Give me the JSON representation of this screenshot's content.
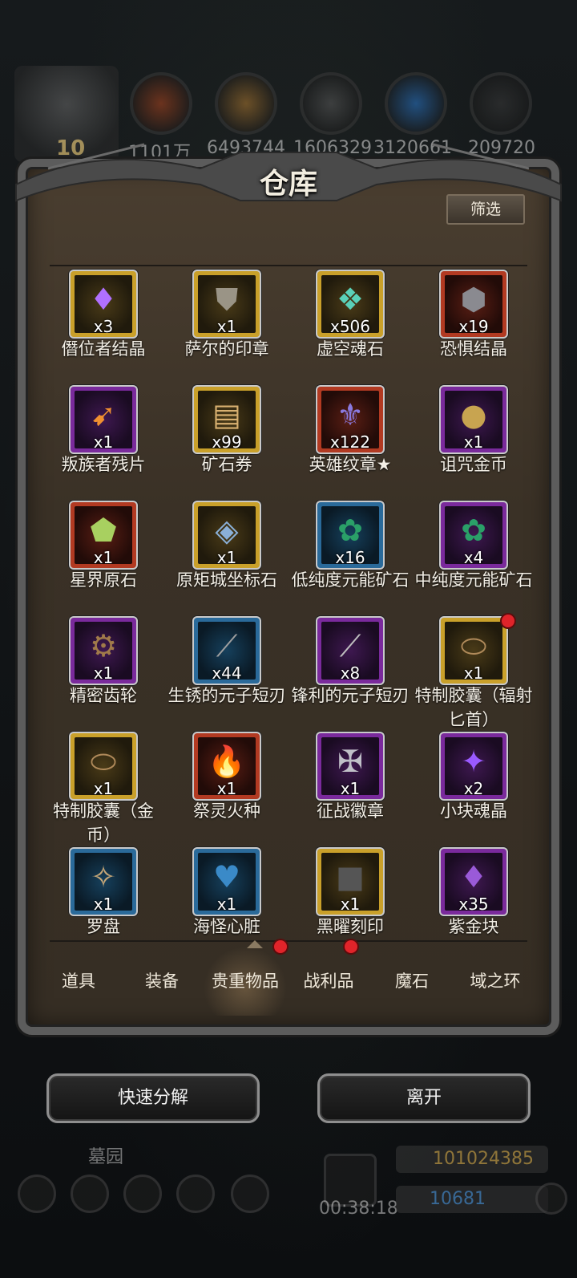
{
  "topbar": {
    "level": "10",
    "resources": [
      {
        "value": "1101万",
        "icon": "wood-log-icon",
        "color": "#b0461e"
      },
      {
        "value": "6493744",
        "icon": "planks-icon",
        "color": "#b07a30"
      },
      {
        "value": "1606329",
        "icon": "iron-ingot-icon",
        "color": "#5a5a5a"
      },
      {
        "value": "3120661",
        "icon": "crystal-icon",
        "color": "#2a7ad0"
      },
      {
        "value": "209720",
        "icon": "black-ingot-icon",
        "color": "#3a3a3a"
      }
    ]
  },
  "panel": {
    "title": "仓库",
    "filter_label": "筛选"
  },
  "items": [
    {
      "name": "僭位者结晶",
      "count": "x3",
      "rarity": "gold",
      "icon": "purple-crystal-icon",
      "glyph": "♦",
      "glyph_color": "#b070ff"
    },
    {
      "name": "萨尔的印章",
      "count": "x1",
      "rarity": "gold",
      "icon": "shield-emblem-icon",
      "glyph": "⛊",
      "glyph_color": "#9a9486"
    },
    {
      "name": "虚空魂石",
      "count": "x506",
      "rarity": "gold",
      "icon": "void-soulstone-icon",
      "glyph": "❖",
      "glyph_color": "#5ad0b8"
    },
    {
      "name": "恐惧结晶",
      "count": "x19",
      "rarity": "red",
      "icon": "fear-crystal-icon",
      "glyph": "⬢",
      "glyph_color": "#8a8a90"
    },
    {
      "name": "叛族者残片",
      "count": "x1",
      "rarity": "purple",
      "icon": "fragment-icon",
      "glyph": "➹",
      "glyph_color": "#f09030"
    },
    {
      "name": "矿石券",
      "count": "x99",
      "rarity": "gold",
      "icon": "scroll-icon",
      "glyph": "▤",
      "glyph_color": "#d8b070"
    },
    {
      "name": "英雄纹章★",
      "count": "x122",
      "rarity": "red",
      "icon": "hero-crest-icon",
      "glyph": "⚜",
      "glyph_color": "#8a7ae0"
    },
    {
      "name": "诅咒金币",
      "count": "x1",
      "rarity": "purple",
      "icon": "cursed-coin-icon",
      "glyph": "●",
      "glyph_color": "#c8a450"
    },
    {
      "name": "星界原石",
      "count": "x1",
      "rarity": "red",
      "icon": "astral-stone-icon",
      "glyph": "⬟",
      "glyph_color": "#a8d060"
    },
    {
      "name": "原矩城坐标石",
      "count": "x1",
      "rarity": "gold",
      "icon": "coordinate-cube-icon",
      "glyph": "◈",
      "glyph_color": "#8ab0d8"
    },
    {
      "name": "低纯度元能矿石",
      "count": "x16",
      "rarity": "blue",
      "icon": "ore-cluster-icon",
      "glyph": "✿",
      "glyph_color": "#2aa068"
    },
    {
      "name": "中纯度元能矿石",
      "count": "x4",
      "rarity": "purple",
      "icon": "ore-cluster-icon",
      "glyph": "✿",
      "glyph_color": "#2aa068"
    },
    {
      "name": "精密齿轮",
      "count": "x1",
      "rarity": "purple",
      "icon": "gear-icon",
      "glyph": "⚙",
      "glyph_color": "#a07a4a"
    },
    {
      "name": "生锈的元子短刃",
      "count": "x44",
      "rarity": "blue",
      "icon": "blade-icon",
      "glyph": "⟋",
      "glyph_color": "#a0a0a0"
    },
    {
      "name": "锋利的元子短刃",
      "count": "x8",
      "rarity": "purple",
      "icon": "blade-icon",
      "glyph": "⟋",
      "glyph_color": "#c0c0c0"
    },
    {
      "name": "特制胶囊（辐射匕首）",
      "count": "x1",
      "rarity": "gold",
      "icon": "capsule-icon",
      "glyph": "⬭",
      "glyph_color": "#b08a5a"
    },
    {
      "name": "特制胶囊（金币）",
      "count": "x1",
      "rarity": "gold",
      "icon": "capsule-icon",
      "glyph": "⬭",
      "glyph_color": "#b08a5a"
    },
    {
      "name": "祭灵火种",
      "count": "x1",
      "rarity": "red",
      "icon": "flame-icon",
      "glyph": "🔥",
      "glyph_color": "#ff9a30"
    },
    {
      "name": "征战徽章",
      "count": "x1",
      "rarity": "purple",
      "icon": "war-badge-icon",
      "glyph": "✠",
      "glyph_color": "#c0c0c8"
    },
    {
      "name": "小块魂晶",
      "count": "x2",
      "rarity": "purple",
      "icon": "soul-crystal-icon",
      "glyph": "✦",
      "glyph_color": "#9a5aff"
    },
    {
      "name": "罗盘",
      "count": "x1",
      "rarity": "blue",
      "icon": "compass-icon",
      "glyph": "✧",
      "glyph_color": "#c8a878"
    },
    {
      "name": "海怪心脏",
      "count": "x1",
      "rarity": "blue",
      "icon": "sea-monster-heart-icon",
      "glyph": "♥",
      "glyph_color": "#3a8ac8"
    },
    {
      "name": "黑曜刻印",
      "count": "x1",
      "rarity": "gold",
      "icon": "obsidian-seal-icon",
      "glyph": "■",
      "glyph_color": "#555555"
    },
    {
      "name": "紫金块",
      "count": "x35",
      "rarity": "purple",
      "icon": "purple-gold-icon",
      "glyph": "♦",
      "glyph_color": "#9a5ad8"
    }
  ],
  "tabs": [
    {
      "label": "道具",
      "badge": false,
      "active": false
    },
    {
      "label": "装备",
      "badge": false,
      "active": false
    },
    {
      "label": "贵重物品",
      "badge": true,
      "active": true
    },
    {
      "label": "战利品",
      "badge": true,
      "active": false
    },
    {
      "label": "魔石",
      "badge": false,
      "active": false
    },
    {
      "label": "域之环",
      "badge": false,
      "active": false
    }
  ],
  "actions": {
    "quick_decompose": "快速分解",
    "leave": "离开"
  },
  "hud": {
    "location": "墓园",
    "timer": "00:38:18",
    "gold": "101024385",
    "gems": "10681"
  }
}
